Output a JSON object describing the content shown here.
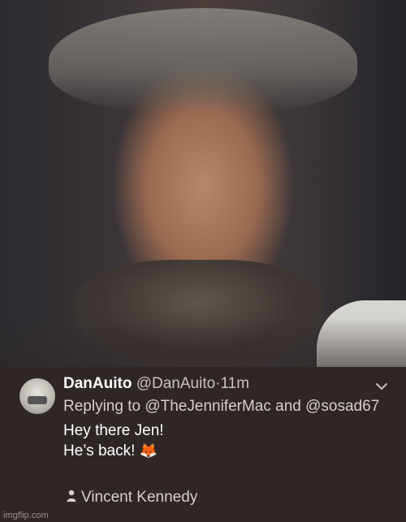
{
  "tweet": {
    "display_name": "DanAuito",
    "handle": "@DanAuito",
    "separator": "·",
    "time": "11m",
    "reply_prefix": "Replying to ",
    "reply_user_1": "@TheJenniferMac",
    "reply_and": " and ",
    "reply_user_2": "@sosad67",
    "body_line1": "Hey there Jen!",
    "body_line2": "He’s back!",
    "body_emoji": "🦊"
  },
  "photo_credit": "Vincent Kennedy",
  "watermark": "imgflip.com",
  "icons": {
    "avatar": "profile-photo",
    "chevron": "chevron-down-icon",
    "person": "person-icon"
  },
  "colors": {
    "background": "#2e2726",
    "primary_text": "#ffffff",
    "secondary_text": "#d7cfcd"
  }
}
